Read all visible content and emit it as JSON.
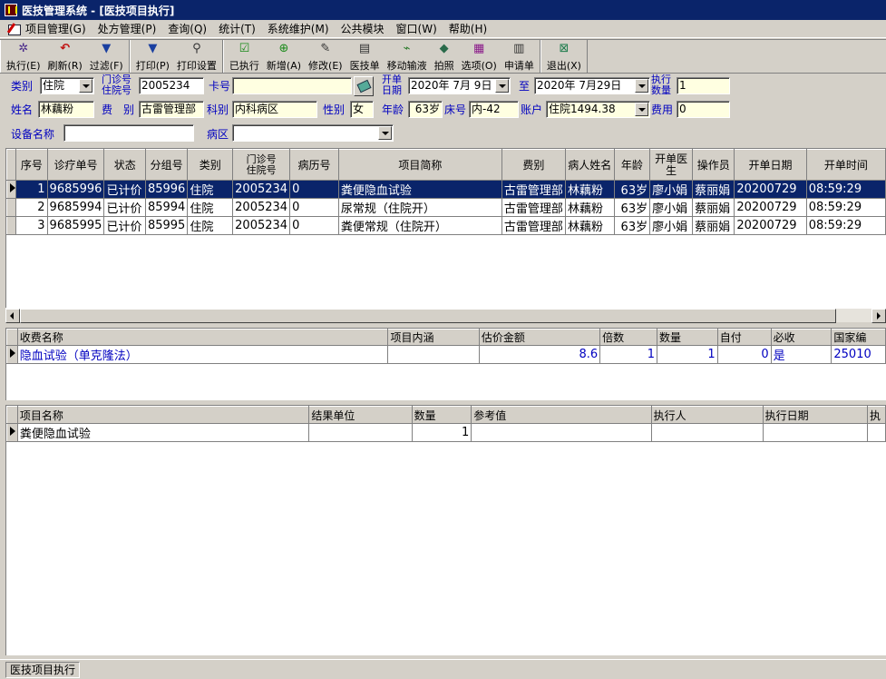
{
  "window": {
    "title": "医技管理系统 - [医技项目执行]"
  },
  "menu": [
    "项目管理(G)",
    "处方管理(P)",
    "查询(Q)",
    "统计(T)",
    "系统维护(M)",
    "公共模块",
    "窗口(W)",
    "帮助(H)"
  ],
  "toolbar": {
    "execute": "执行(E)",
    "refresh": "刷新(R)",
    "filter": "过滤(F)",
    "print": "打印(P)",
    "print_setup": "打印设置",
    "executed": "已执行",
    "add": "新增(A)",
    "modify": "修改(E)",
    "tech_form": "医技单",
    "mobile_infusion": "移动输液",
    "photo": "拍照",
    "options": "选项(O)",
    "request_form": "申请单",
    "exit": "退出(X)"
  },
  "query": {
    "category_label": "类别",
    "category_value": "住院",
    "opno_label_1": "门诊号",
    "opno_label_2": "住院号",
    "opno_value": "2005234",
    "card_label": "卡号",
    "card_value": "",
    "open_date_label_1": "开单",
    "open_date_label_2": "日期",
    "date_from": "2020年 7月 9日",
    "to_label": "至",
    "date_to": "2020年 7月29日",
    "exec_qty_label_1": "执行",
    "exec_qty_label_2": "数量",
    "exec_qty_value": "1",
    "name_label": "姓名",
    "name_value": "林藕粉",
    "fee_label": "费　别",
    "fee_value": "古雷管理部",
    "dept_label": "科别",
    "dept_value": "内科病区",
    "sex_label": "性别",
    "sex_value": "女",
    "age_label": "年龄",
    "age_value": "63岁",
    "bed_label": "床号",
    "bed_value": "内-42",
    "account_label": "账户",
    "account_value": "住院1494.38",
    "cost_label": "费用",
    "cost_value": "0",
    "device_label": "设备名称",
    "device_value": "",
    "ward_label": "病区",
    "ward_value": ""
  },
  "main_grid": {
    "headers": [
      "序号",
      "诊疗单号",
      "状态",
      "分组号",
      "类别",
      "门诊号\n住院号",
      "病历号",
      "项目简称",
      "费别",
      "病人姓名",
      "年龄",
      "开单医\n生",
      "操作员",
      "开单日期",
      "开单时间"
    ],
    "rows": [
      [
        "1",
        "9685996",
        "已计价",
        "85996",
        "住院",
        "2005234",
        "0",
        "粪便隐血试验",
        "古雷管理部",
        "林藕粉",
        "63岁",
        "廖小娟",
        "蔡丽娟",
        "20200729",
        "08:59:29"
      ],
      [
        "2",
        "9685994",
        "已计价",
        "85994",
        "住院",
        "2005234",
        "0",
        "尿常规（住院开）",
        "古雷管理部",
        "林藕粉",
        "63岁",
        "廖小娟",
        "蔡丽娟",
        "20200729",
        "08:59:29"
      ],
      [
        "3",
        "9685995",
        "已计价",
        "85995",
        "住院",
        "2005234",
        "0",
        "粪便常规（住院开）",
        "古雷管理部",
        "林藕粉",
        "63岁",
        "廖小娟",
        "蔡丽娟",
        "20200729",
        "08:59:29"
      ]
    ]
  },
  "charge_grid": {
    "headers": [
      "收费名称",
      "项目内涵",
      "估价金额",
      "倍数",
      "数量",
      "自付",
      "必收",
      "国家编"
    ],
    "rows": [
      [
        "隐血试验（单克隆法）",
        "",
        "8.6",
        "1",
        "1",
        "0",
        "是",
        "25010"
      ]
    ]
  },
  "result_grid": {
    "headers": [
      "项目名称",
      "结果单位",
      "数量",
      "参考值",
      "执行人",
      "执行日期",
      "执"
    ],
    "rows": [
      [
        "粪便隐血试验",
        "",
        "1",
        "",
        "",
        "",
        ""
      ]
    ]
  },
  "status": {
    "panel": "医技项目执行"
  }
}
